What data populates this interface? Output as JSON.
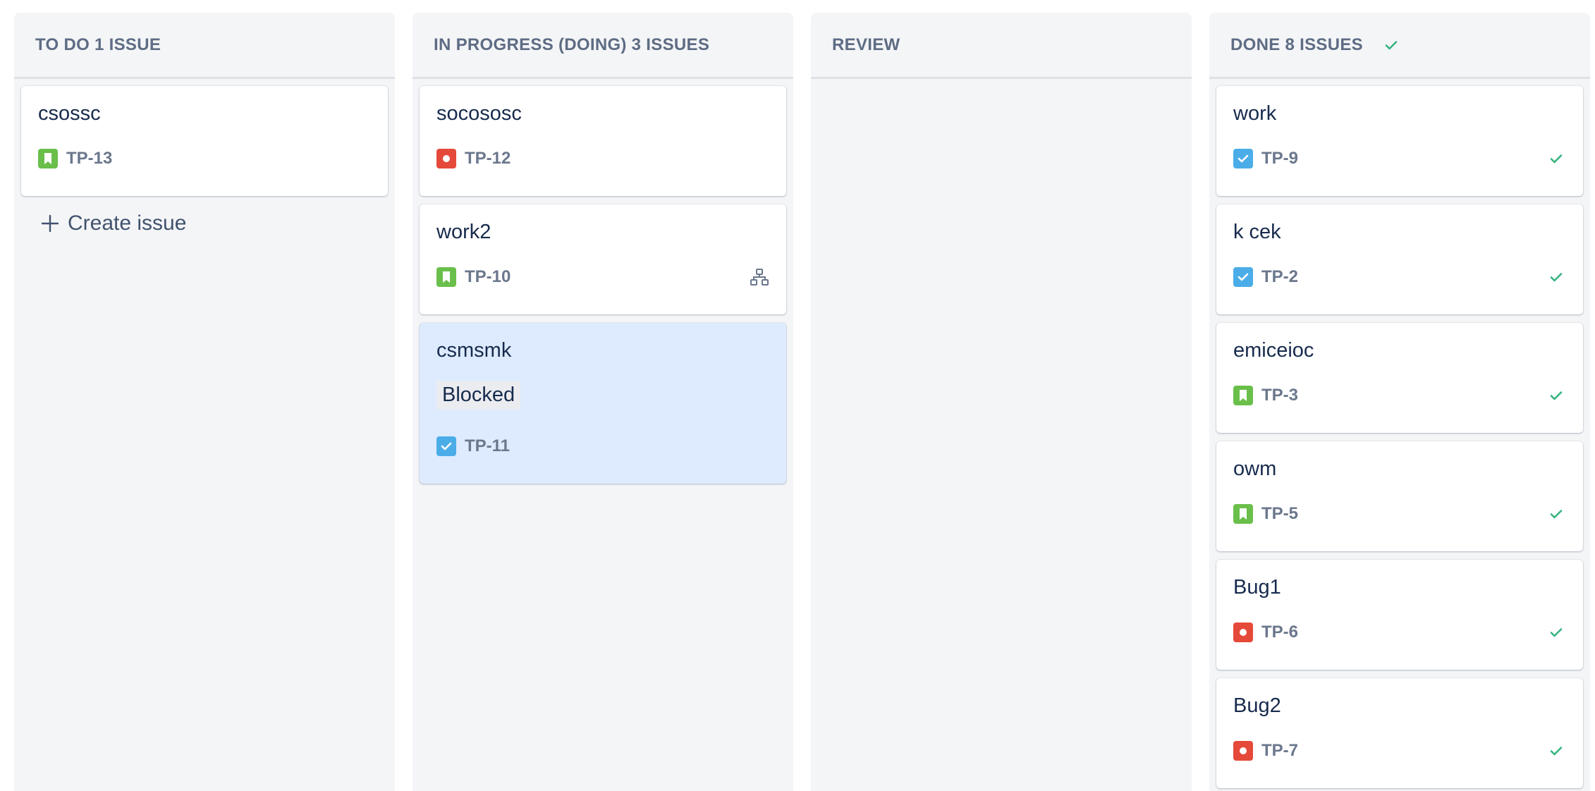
{
  "colors": {
    "story": "#6abf4b",
    "bug": "#e5493a",
    "task": "#4bade8",
    "done_check": "#36b37e",
    "column_bg": "#f4f5f7",
    "selected_card_bg": "#deebff"
  },
  "columns": {
    "todo": {
      "title": "TO DO 1 ISSUE",
      "cards": [
        {
          "title": "csossc",
          "key": "TP-13",
          "type_icon": "story-icon"
        }
      ],
      "create_label": "Create issue"
    },
    "progress": {
      "title": "IN PROGRESS (DOING) 3 ISSUES",
      "cards": [
        {
          "title": "socososc",
          "key": "TP-12",
          "type_icon": "bug-icon"
        },
        {
          "title": "work2",
          "key": "TP-10",
          "type_icon": "story-icon",
          "extra_icon": "child-issues-icon"
        },
        {
          "title": "csmsmk",
          "label": "Blocked",
          "key": "TP-11",
          "type_icon": "task-icon",
          "selected": true
        }
      ]
    },
    "review": {
      "title": "REVIEW",
      "cards": []
    },
    "done": {
      "title": "DONE 8 ISSUES",
      "header_icon": "check-icon",
      "cards": [
        {
          "title": "work",
          "key": "TP-9",
          "type_icon": "task-icon",
          "status_icon": "check-icon"
        },
        {
          "title": "k cek",
          "key": "TP-2",
          "type_icon": "task-icon",
          "status_icon": "check-icon"
        },
        {
          "title": "emiceioc",
          "key": "TP-3",
          "type_icon": "story-icon",
          "status_icon": "check-icon"
        },
        {
          "title": "owm",
          "key": "TP-5",
          "type_icon": "story-icon",
          "status_icon": "check-icon"
        },
        {
          "title": "Bug1",
          "key": "TP-6",
          "type_icon": "bug-icon",
          "status_icon": "check-icon"
        },
        {
          "title": "Bug2",
          "key": "TP-7",
          "type_icon": "bug-icon",
          "status_icon": "check-icon"
        }
      ]
    }
  }
}
